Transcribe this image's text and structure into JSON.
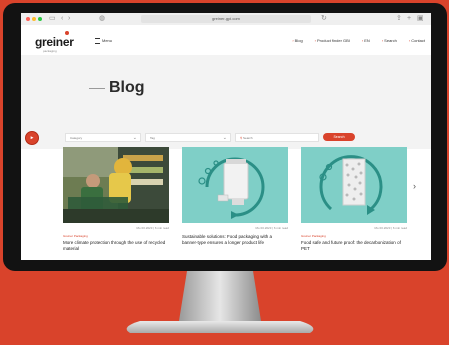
{
  "browser": {
    "url": "greiner-gpi.com",
    "traffic_colors": [
      "#ff5f57",
      "#febc2e",
      "#28c840"
    ]
  },
  "site": {
    "logo": "greiner",
    "logo_sub": "packaging",
    "menu_label": "Menu",
    "nav": [
      "Blog",
      "Product finder GBI",
      "EN",
      "Search",
      "Contact"
    ]
  },
  "hero": {
    "title": "Blog"
  },
  "filters": {
    "category": "Category",
    "tag": "Tag",
    "search_placeholder": "Search",
    "search_button": "Search"
  },
  "cards": [
    {
      "date": "Mo 00.2023 | 6 min read",
      "category": "Greiner Packaging",
      "title": "More climate protection through the use of recycled material"
    },
    {
      "date": "Mo 00.2023 | 6 min read",
      "category": "",
      "title": "Sustainable solutions: Food packaging with a banner-type ensures a longer product life"
    },
    {
      "date": "Mo 00.2023 | 6 min read",
      "category": "Greiner Packaging",
      "title": "Food safe and future proof: the decarbonization of PET"
    }
  ],
  "colors": {
    "accent": "#d9432b",
    "teal": "#7fcfc7"
  }
}
